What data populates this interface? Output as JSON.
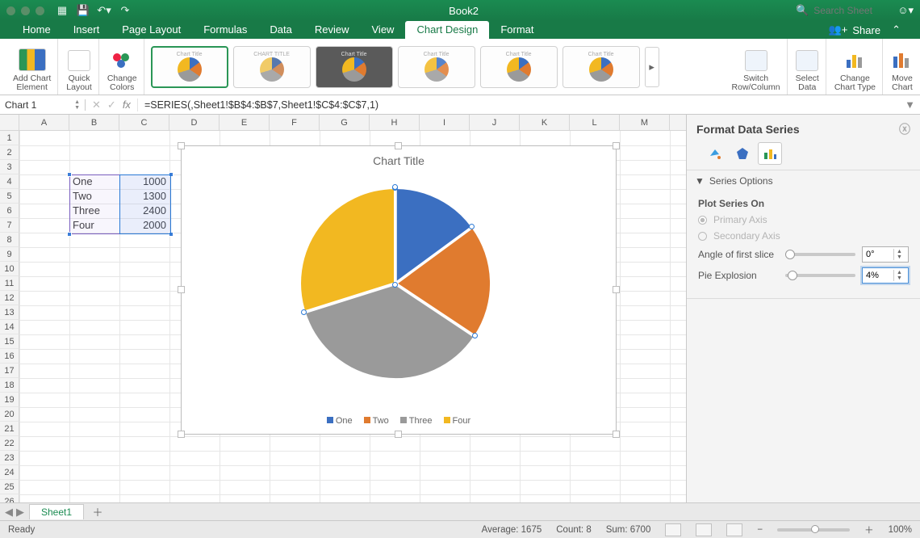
{
  "window": {
    "title": "Book2"
  },
  "search": {
    "placeholder": "Search Sheet"
  },
  "menus": {
    "items": [
      "Home",
      "Insert",
      "Page Layout",
      "Formulas",
      "Data",
      "Review",
      "View",
      "Chart Design",
      "Format"
    ],
    "active_index": 7,
    "share": "Share"
  },
  "ribbon": {
    "add_chart_element": "Add Chart\nElement",
    "quick_layout": "Quick\nLayout",
    "change_colors": "Change\nColors",
    "switch_row_col": "Switch\nRow/Column",
    "select_data": "Select\nData",
    "change_chart_type": "Change\nChart Type",
    "move_chart": "Move\nChart"
  },
  "formula_bar": {
    "name_box": "Chart 1",
    "formula": "=SERIES(,Sheet1!$B$4:$B$7,Sheet1!$C$4:$C$7,1)"
  },
  "columns": [
    "A",
    "B",
    "C",
    "D",
    "E",
    "F",
    "G",
    "H",
    "I",
    "J",
    "K",
    "L",
    "M"
  ],
  "rows": 26,
  "data_cells": {
    "B4": "One",
    "C4": "1000",
    "B5": "Two",
    "C5": "1300",
    "B6": "Three",
    "C6": "2400",
    "B7": "Four",
    "C7": "2000"
  },
  "chart_data": {
    "type": "pie",
    "title": "Chart Title",
    "categories": [
      "One",
      "Two",
      "Three",
      "Four"
    ],
    "values": [
      1000,
      1300,
      2400,
      2000
    ],
    "colors": [
      "#3b6fc1",
      "#e07b2f",
      "#9a9a9a",
      "#f2b821"
    ],
    "explosion_pct": 4
  },
  "format_pane": {
    "title": "Format Data Series",
    "section": "Series Options",
    "plot_on_label": "Plot Series On",
    "primary_axis": "Primary Axis",
    "secondary_axis": "Secondary Axis",
    "angle_label": "Angle of first slice",
    "angle_value": "0°",
    "explosion_label": "Pie Explosion",
    "explosion_value": "4%"
  },
  "sheet_tabs": {
    "active": "Sheet1"
  },
  "status": {
    "ready": "Ready",
    "average": "Average: 1675",
    "count": "Count: 8",
    "sum": "Sum: 6700",
    "zoom": "100%"
  }
}
